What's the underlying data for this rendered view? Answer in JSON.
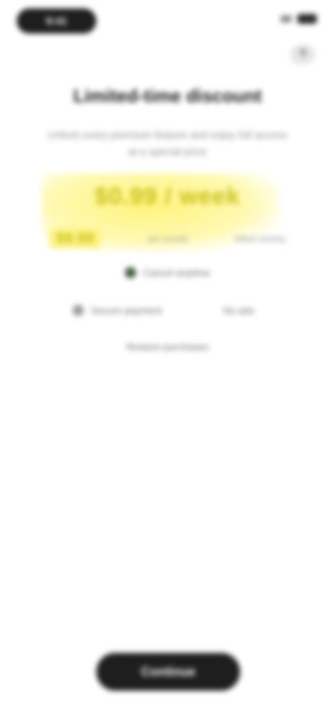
{
  "status_bar": {
    "time": "9:41",
    "battery": "100"
  },
  "header": {
    "help_label": "?"
  },
  "offer": {
    "title": "Limited-time discount",
    "description": "Unlock every premium feature and enjoy full access at a special price",
    "price_main": "$0.99 / week",
    "price_old": "$9.99",
    "price_note": "per month",
    "price_note_2": "billed weekly",
    "feature_1": "Cancel anytime",
    "feature_2_left": "Secure payment",
    "feature_2_right": "No ads",
    "feature_3": "Restore purchases"
  },
  "footer": {
    "cta_label": "Continue"
  },
  "colors": {
    "accent_yellow": "#fff37a",
    "price_text": "#c9c11a",
    "button_dark": "#1e1e1e"
  }
}
